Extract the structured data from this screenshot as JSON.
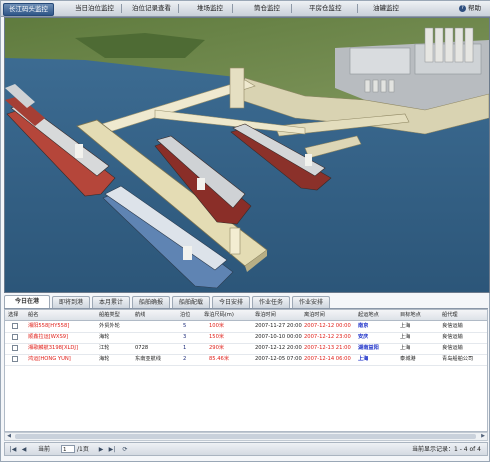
{
  "app": {
    "title": "长江码头监控"
  },
  "nav": {
    "items": [
      "当日泊位监控",
      "泊位记录查看",
      "堆场监控",
      "筒仓监控",
      "平房仓监控",
      "油罐监控"
    ],
    "help": "帮助"
  },
  "tabs": [
    "今日在港",
    "即将到港",
    "本月累计",
    "船舶确报",
    "船舶配载",
    "今日安排",
    "作业任务",
    "作业安排"
  ],
  "table": {
    "columns": [
      "选择",
      "船名",
      "船舶类型",
      "航线",
      "泊位",
      "靠泊尺码(m)",
      "靠泊时间",
      "离泊时间",
      "起运地点",
      "目标地点",
      "船代理"
    ],
    "rows": [
      [
        "湘阳558[HY558]",
        "外贸外轮",
        "",
        "5",
        "100米",
        "2007-11-27 20:00",
        "2007-12-12 00:00",
        "南京",
        "上海",
        "良信运输"
      ],
      [
        "顺鑫拉运[WXS9]",
        "海轮",
        "",
        "3",
        "150米",
        "2007-10-10 00:00",
        "2007-12-12 23:00",
        "安庆",
        "上海",
        "良信运输"
      ],
      [
        "湘歌麟航3198[XLDJ]",
        "江轮",
        "0728",
        "1",
        "290米",
        "2007-12-12 20:00",
        "2007-12-13 21:00",
        "湖南益阳",
        "上海",
        "良信运输"
      ],
      [
        "鸿运[HONG YUN]",
        "海轮",
        "东南亚航线",
        "2",
        "85.46米",
        "2007-12-05 07:00",
        "2007-12-14 06:00",
        "上海",
        "泰城港",
        "青岛船舶公司"
      ]
    ]
  },
  "pager": {
    "page_prefix": "当前",
    "page_value": "1",
    "page_suffix": "/1页",
    "summary": "当前显示记录：1 - 4 of 4"
  }
}
